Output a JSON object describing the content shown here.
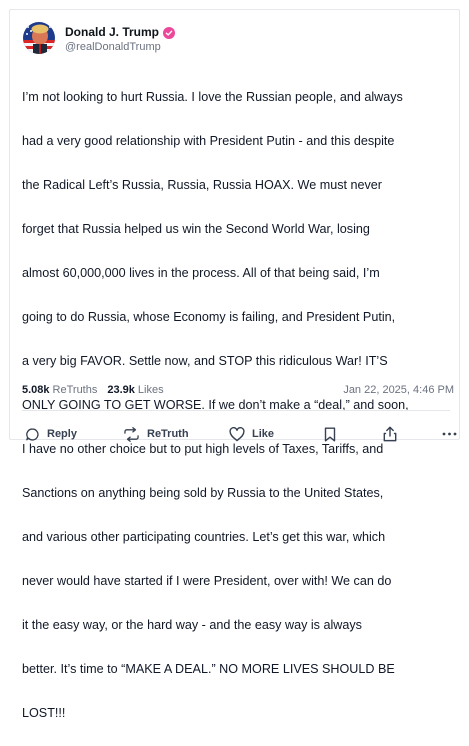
{
  "author": {
    "display_name": "Donald J. Trump",
    "handle": "@realDonaldTrump",
    "verified_icon": "verified-badge-icon",
    "badge_color": "#ec4899"
  },
  "post": {
    "text": "I’m not looking to hurt Russia. I love the Russian people, and always had a very good relationship with President Putin - and this despite the Radical Left’s Russia, Russia, Russia HOAX. We must never forget that Russia helped us win the Second World War, losing almost 60,000,000 lives in the process. All of that being said, I’m going to do Russia, whose Economy is failing, and President Putin, a very big FAVOR. Settle now, and STOP this ridiculous War! IT’S ONLY GOING TO GET WORSE. If we don’t make a “deal,” and soon, I have no other choice but to put high levels of Taxes, Tariffs, and Sanctions on anything being sold by Russia to the United States, and various other participating countries. Let’s get this war, which never would have started if I were President, over with! We can do it the easy way, or the hard way - and the easy way is always better. It’s time to “MAKE A DEAL.” NO MORE LIVES SHOULD BE LOST!!!",
    "lines": [
      "I’m not looking to hurt Russia. I love the Russian people, and always",
      "had a very good relationship with President Putin - and this despite",
      "the Radical Left’s Russia, Russia, Russia HOAX. We must never",
      "forget that Russia helped us win the Second World War, losing",
      "almost 60,000,000 lives in the process. All of that being said, I’m",
      "going to do Russia, whose Economy is failing, and President Putin,",
      "a very big FAVOR. Settle now, and STOP this ridiculous War! IT’S",
      "ONLY GOING TO GET WORSE. If we don’t make a “deal,” and soon,",
      "I have no other choice but to put high levels of Taxes, Tariffs, and",
      "Sanctions on anything being sold by Russia to the United States,",
      "and various other participating countries. Let’s get this war, which",
      "never would have started if I were President, over with! We can do",
      "it the easy way, or the hard way - and the easy way is always",
      "better. It’s time to “MAKE A DEAL.” NO MORE LIVES SHOULD BE",
      "LOST!!!"
    ],
    "retruths_count": "5.08k",
    "retruths_label": "ReTruths",
    "likes_count": "23.9k",
    "likes_label": "Likes",
    "timestamp": "Jan 22, 2025, 4:46 PM"
  },
  "actions": {
    "reply_label": "Reply",
    "retruth_label": "ReTruth",
    "like_label": "Like",
    "icons": [
      "reply-icon",
      "retruth-icon",
      "like-icon",
      "bookmark-icon",
      "share-icon",
      "more-icon"
    ]
  }
}
